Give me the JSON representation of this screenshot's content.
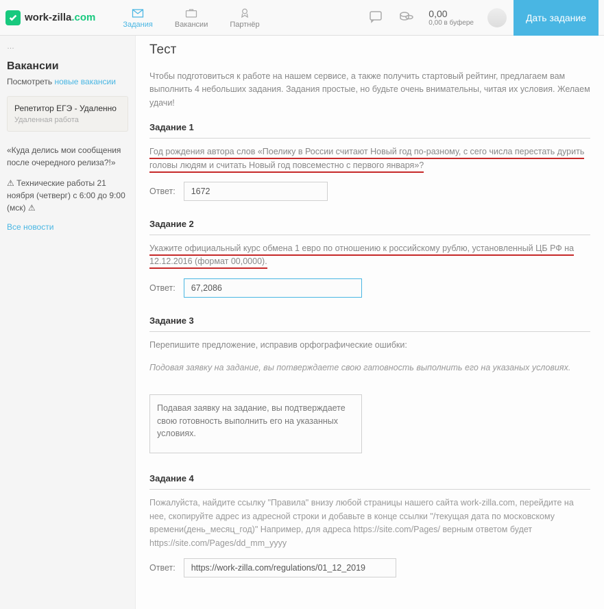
{
  "header": {
    "logo_prefix": "work",
    "logo_mid": "-zilla",
    "logo_suffix": ".com",
    "nav": [
      {
        "label": "Задания",
        "icon": "mail",
        "active": true
      },
      {
        "label": "Вакансии",
        "icon": "briefcase",
        "active": false
      },
      {
        "label": "Партнёр",
        "icon": "badge",
        "active": false
      }
    ],
    "balance_amount": "0,00",
    "balance_sub": "0,00 в буфере",
    "cta": "Дать задание"
  },
  "sidebar": {
    "vacancies_h": "Вакансии",
    "view_prefix": "Посмотреть",
    "view_link": " новые вакансии",
    "job": {
      "title": "Репетитор ЕГЭ - Удаленно",
      "sub": "Удаленная работа"
    },
    "news": [
      "«Куда делись мои сообщения после очередного релиза?!»",
      "⚠ Технические работы 21 ноября (четверг) с 6:00 до 9:00 (мск) ⚠"
    ],
    "all_news": "Все новости"
  },
  "main": {
    "title": "Тест",
    "intro": "Чтобы подготовиться к работе на нашем сервисе, а также получить стартовый рейтинг, предлагаем вам выполнить 4 небольших задания. Задания простые, но будьте очень внимательны, читая их условия. Желаем удачи!",
    "answer_label": "Ответ:",
    "task1": {
      "h": "Задание 1",
      "q": "Год рождения автора слов «Поелику в России считают Новый год по-разному, с сего числа перестать дурить головы людям и считать Новый год повсеместно с первого января»?",
      "value": "1672"
    },
    "task2": {
      "h": "Задание 2",
      "q": "Укажите официальный курс обмена 1 евро по отношению к российскому рублю, установленный ЦБ РФ на 12.12.2016 (формат 00,0000).",
      "value": "67,2086"
    },
    "task3": {
      "h": "Задание 3",
      "q1": "Перепишите предложение, исправив орфографические ошибки:",
      "q2": "Подовая заявку на задание, вы потверждаете свою гатовность выполнить его на указаных условиях.",
      "value": "Подавая заявку на задание, вы подтверждаете свою готовность выполнить его на указанных условиях."
    },
    "task4": {
      "h": "Задание 4",
      "q": "Пожалуйста, найдите ссылку \"Правила\" внизу любой страницы нашего сайта work-zilla.com, перейдите на нее, скопируйте адрес из адресной строки и добавьте в конце ссылки \"/текущая дата по московскому времени(день_месяц_год)\" Например, для адреса https://site.com/Pages/ верным ответом будет https://site.com/Pages/dd_mm_yyyy",
      "value": "https://work-zilla.com/regulations/01_12_2019"
    }
  }
}
